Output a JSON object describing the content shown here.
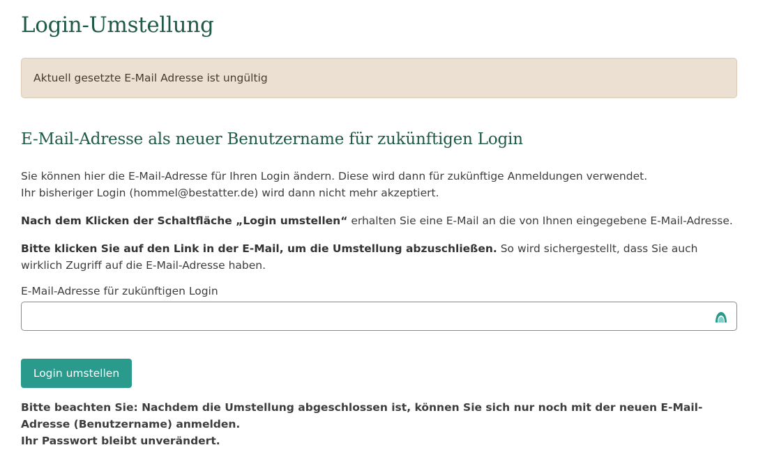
{
  "page": {
    "title": "Login-Umstellung"
  },
  "alert": {
    "message": "Aktuell gesetzte E-Mail Adresse ist ungültig"
  },
  "section": {
    "title": "E-Mail-Adresse als neuer Benutzername für zukünftigen Login",
    "intro_line1": "Sie können hier die E-Mail-Adresse für Ihren Login ändern. Diese wird dann für zukünftige Anmeldungen verwendet.",
    "intro_line2": "Ihr bisheriger Login (hommel@bestatter.de) wird dann nicht mehr akzeptiert.",
    "info_bold": "Nach dem Klicken der Schaltfläche „Login umstellen“",
    "info_rest": " erhalten Sie eine E-Mail an die von Ihnen eingegebene E-Mail-Adresse.",
    "confirm_bold": "Bitte klicken Sie auf den Link in der E-Mail, um die Umstellung abzuschließen.",
    "confirm_rest": " So wird sichergestellt, dass Sie auch wirklich Zugriff auf die E-Mail-Adresse haben."
  },
  "form": {
    "email_label": "E-Mail-Adresse für zukünftigen Login",
    "email_value": "",
    "email_placeholder": "",
    "submit_label": "Login umstellen",
    "field_icon": "password-manager-icon",
    "accent_color": "#2a9a8c"
  },
  "note": {
    "line1": "Bitte beachten Sie: Nachdem die Umstellung abgeschlossen ist, können Sie sich nur noch mit der neuen E-Mail-Adresse (Benutzername) anmelden.",
    "line2": "Ihr Passwort bleibt unverändert."
  }
}
